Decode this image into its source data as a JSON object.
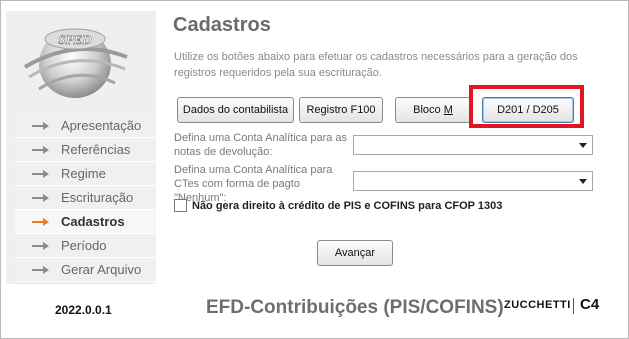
{
  "title": "Cadastros",
  "description": "Utilize os botões abaixo para efetuar os cadastros necessários para a geração dos registros requeridos pela sua escrituração.",
  "logo_text": "SPED",
  "nav": {
    "items": [
      {
        "label": "Apresentação"
      },
      {
        "label": "Referências"
      },
      {
        "label": "Regime"
      },
      {
        "label": "Escrituração"
      },
      {
        "label": "Cadastros"
      },
      {
        "label": "Período"
      },
      {
        "label": "Gerar Arquivo"
      }
    ],
    "active_index": 4,
    "arrow_color": "#8c8c8c",
    "active_arrow_color": "#f07a1a"
  },
  "buttons": {
    "dados": "Dados do contabilista",
    "f100": "Registro F100",
    "bloco_prefix": "Bloco ",
    "bloco_underlined": "M",
    "d201": "D201 / D205"
  },
  "fields": {
    "devolucao_label": "Defina uma Conta Analítica para as notas de devolução:",
    "devolucao_value": "",
    "ctes_label": "Defina uma Conta Analítica para CTes com forma de pagto \"Nenhum\":",
    "ctes_value": ""
  },
  "checkbox_label": "Não gera direito à crédito de PIS e COFINS para CFOP 1303",
  "advance_label": "Avançar",
  "version": "2022.0.0.1",
  "footer_title": "EFD-Contribuições (PIS/COFINS)",
  "brand": "ZUCCHETTI",
  "brand2": "C4",
  "colors": {
    "highlight_box": "#e01722"
  }
}
